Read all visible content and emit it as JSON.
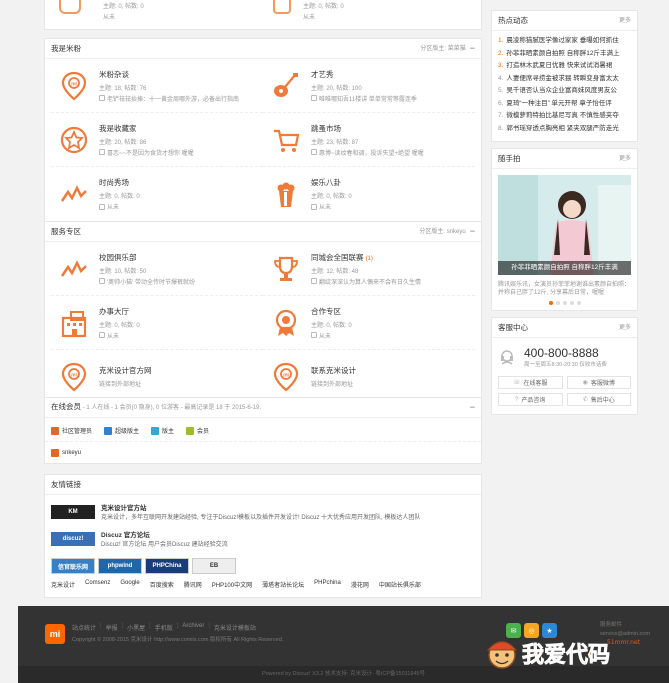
{
  "top_partial": {
    "a": {
      "stat": "主题: 0, 帖数: 0",
      "last": "从未"
    },
    "b": {
      "stat": "主题: 0, 帖数: 0",
      "last": "从未"
    }
  },
  "fans_section": {
    "title": "我是米粉",
    "moderator": "分区版主: 菜菜猫",
    "forums": [
      {
        "name": "米粉杂谈",
        "stat": "主题: 18, 帖数: 76",
        "last": "老铲祛祛抬捧：十一黄金周哪外游，必备出行指南",
        "icon": "mi-pin-icon"
      },
      {
        "name": "才艺秀",
        "stat": "主题: 20, 帖数: 100",
        "last": "唯唯哪知吾11楼讲 单单常常等露连季",
        "icon": "guitar-icon"
      },
      {
        "name": "我是收藏家",
        "stat": "主题: 20, 帖数: 86",
        "last": "喜恋~~不是因为食货才想你 喔喔",
        "icon": "star-icon"
      },
      {
        "name": "跳蚤市场",
        "stat": "主题: 23, 帖数: 87",
        "last": "惠博~读纹春和调，投诉失望+绝望 喔喔",
        "icon": "cart-icon"
      },
      {
        "name": "时尚秀场",
        "stat": "主题: 0, 帖数: 0",
        "last": "从未",
        "icon": "trend-icon"
      },
      {
        "name": "娱乐八卦",
        "stat": "主题: 0, 帖数: 0",
        "last": "从未",
        "icon": "popcorn-icon"
      }
    ]
  },
  "service_section": {
    "title": "服务专区",
    "moderator": "分区版主: snkeyu",
    "forums": [
      {
        "name": "校园俱乐部",
        "new": "",
        "stat": "主题: 10, 帖数: 50",
        "last": "'奥帅小猫' 带动全传时节爆裤就纷",
        "icon": "trend-icon"
      },
      {
        "name": "同城会全国联赛",
        "new": "(1)",
        "stat": "主题: 12, 帖数: 48",
        "last": "翻绽深深认为算人偶来不会有日久生情",
        "icon": "trophy-icon"
      },
      {
        "name": "办事大厅",
        "new": "",
        "stat": "主题: 0, 帖数: 0",
        "last": "从未",
        "icon": "building-icon"
      },
      {
        "name": "合作专区",
        "new": "",
        "stat": "主题: 0, 帖数: 0",
        "last": "从未",
        "icon": "badge-icon"
      },
      {
        "name": "克米设计官方网",
        "new": "",
        "stat": "链接到外部地址",
        "last": "",
        "icon": "mi-pin-icon"
      },
      {
        "name": "联系克米设计",
        "new": "",
        "stat": "链接到外部地址",
        "last": "",
        "icon": "mi-pin-icon"
      }
    ]
  },
  "online": {
    "title": "在线会员",
    "summary": "- 1 人在线 - 1 会员(0 隐身), 0 位游客 - 最高记录是 18 于 2015-6-19.",
    "legend": [
      {
        "label": "社区管理员",
        "color": "#e2682a"
      },
      {
        "label": "超级版主",
        "color": "#2e82d6"
      },
      {
        "label": "版主",
        "color": "#2eaad6"
      },
      {
        "label": "会员",
        "color": "#9bbd2e"
      }
    ],
    "user": "snkeyu"
  },
  "links": {
    "title": "友情链接",
    "items": [
      {
        "logo": "KM",
        "logo_color": "#222",
        "name": "克米设计官方站",
        "desc": "克米设计，多年互联网开发建站经验, 专注于Discuz!模板以及插件开发设计! Discuz 十大优秀应用开发团队, 模板达人团队"
      },
      {
        "logo": "discuz!",
        "logo_color": "#3a6fb5",
        "name": "Discuz 官方论坛",
        "desc": "Discuz! 官方论坛 用户会员Discuz 建站经验交流"
      }
    ],
    "logos": [
      {
        "text": "信官联乐网",
        "color": "#3a7fc2"
      },
      {
        "text": "phpwind",
        "color": "#2266aa"
      },
      {
        "text": "PHPChina",
        "color": "#1a3d7a"
      },
      {
        "text": "EB",
        "color": "#eee"
      }
    ],
    "text_links": [
      "克米设计",
      "Comsenz",
      "Google",
      "百度搜索",
      "腾讯网",
      "PHP100中文网",
      "薄塔者站长论坛",
      "PHPchina",
      "漫花网",
      "中国站长俱乐部"
    ]
  },
  "hot": {
    "title": "热点动态",
    "more": "更多",
    "items": [
      "晨凌称猫腻医学像过家家 垂曝如何抓住",
      "孙菲菲晒素颜自拍照 自称胖12斤丰满上",
      "打造林木武夏日优雅 快来试试消暑裙",
      "人妻便席寻捞金被求猥 转瞬变身富太太",
      "吴千语否认当众企业富商妹风度男友公",
      "夏琦“一种注目” 单元开帮 章子怡任评",
      "微模萝莉特拍比基尼写真 不慎性感夹夺",
      "郭书瑶穿透点胸亮相 紧夹双腿严防走光"
    ]
  },
  "photo": {
    "title": "随手拍",
    "more": "更多",
    "caption": "孙菲菲晒素颜自拍照 自称胖12斤丰满",
    "desc": "腾讯娱乐讯，女演员孙菲菲地谢谁出素颜自拍照：并称自己胖了12斤, 分享幕后日常，喔喔"
  },
  "service": {
    "title": "客服中心",
    "more": "更多",
    "phone": "400-800-8888",
    "hours": "周一至周五8:30-20:30 仅收市话费",
    "buttons": [
      "在线客服",
      "客服微博",
      "产品咨询",
      "售后中心"
    ]
  },
  "footer": {
    "logo": "mi",
    "nav": [
      "站点统计",
      "举报",
      "小黑屋",
      "手机版",
      "Archiver",
      "克米设计模板站"
    ],
    "copyright": "Copyright © 2008-2015 克米设计 http://www.comiis.com 版权所有 All Rights Reserved.",
    "email_label": "服务邮件",
    "email": "service@admin.com",
    "powered": "Powered by Discuz! X3.2  技术支持: 克米设计-  粤ICP备15011945号",
    "watermark": "我爱代码 51mmr.net"
  }
}
